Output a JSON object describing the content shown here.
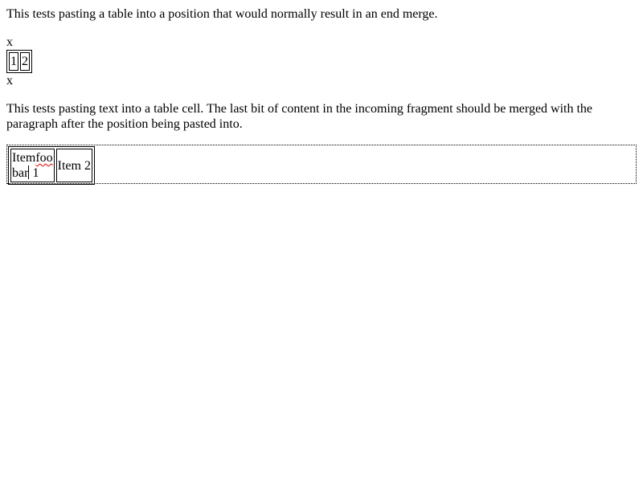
{
  "intro_text": "This tests pasting a table into a position that would normally result in an end merge.",
  "marker_top": "x",
  "mini_table": {
    "cells": [
      "1",
      "2"
    ]
  },
  "marker_bottom": "x",
  "second_text": "This tests pasting text into a table cell. The last bit of content in the incoming fragment should be merged with the paragraph after the position being pasted into.",
  "item_table": {
    "cell1_prefix": "Item",
    "cell1_misspelled": "foo",
    "cell1_line2_a": "bar",
    "cell1_line2_b": "1",
    "cell2": "Item 2"
  },
  "colors": {
    "spellcheck_underline": "#e00000"
  }
}
